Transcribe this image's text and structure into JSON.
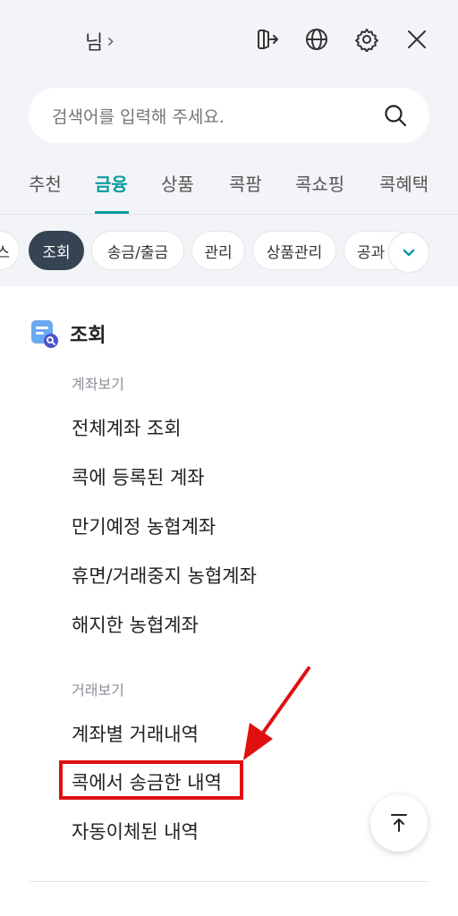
{
  "header": {
    "user_name": "님",
    "user_chevron": "›",
    "icons": [
      "logout-icon",
      "globe-icon",
      "gear-icon",
      "close-icon"
    ]
  },
  "search": {
    "placeholder": "검색어를 입력해 주세요.",
    "icon": "search-icon"
  },
  "tabs": [
    {
      "label": "추천",
      "active": false
    },
    {
      "label": "금융",
      "active": true
    },
    {
      "label": "상품",
      "active": false
    },
    {
      "label": "콕팜",
      "active": false
    },
    {
      "label": "콕쇼핑",
      "active": false
    },
    {
      "label": "콕혜택",
      "active": false
    }
  ],
  "chips": [
    {
      "label": "스",
      "active": false
    },
    {
      "label": "조회",
      "active": true
    },
    {
      "label": "송금/출금",
      "active": false
    },
    {
      "label": "관리",
      "active": false
    },
    {
      "label": "상품관리",
      "active": false
    },
    {
      "label": "공과",
      "active": false
    }
  ],
  "section": {
    "title": "조회",
    "icon": "account-search-icon",
    "groups": [
      {
        "label": "계좌보기",
        "items": [
          "전체계좌 조회",
          "콕에 등록된 계좌",
          "만기예정 농협계좌",
          "휴면/거래중지 농협계좌",
          "해지한 농협계좌"
        ]
      },
      {
        "label": "거래보기",
        "items": [
          "계좌별 거래내역",
          "콕에서 송금한 내역",
          "자동이체된 내역"
        ]
      }
    ]
  },
  "colors": {
    "accent": "#0f9aa0",
    "chip_active": "#364352",
    "header_bg": "#f2f4f7",
    "annotation_red": "#e01010"
  },
  "scroll_top_icon": "arrow-up-to-top-icon"
}
